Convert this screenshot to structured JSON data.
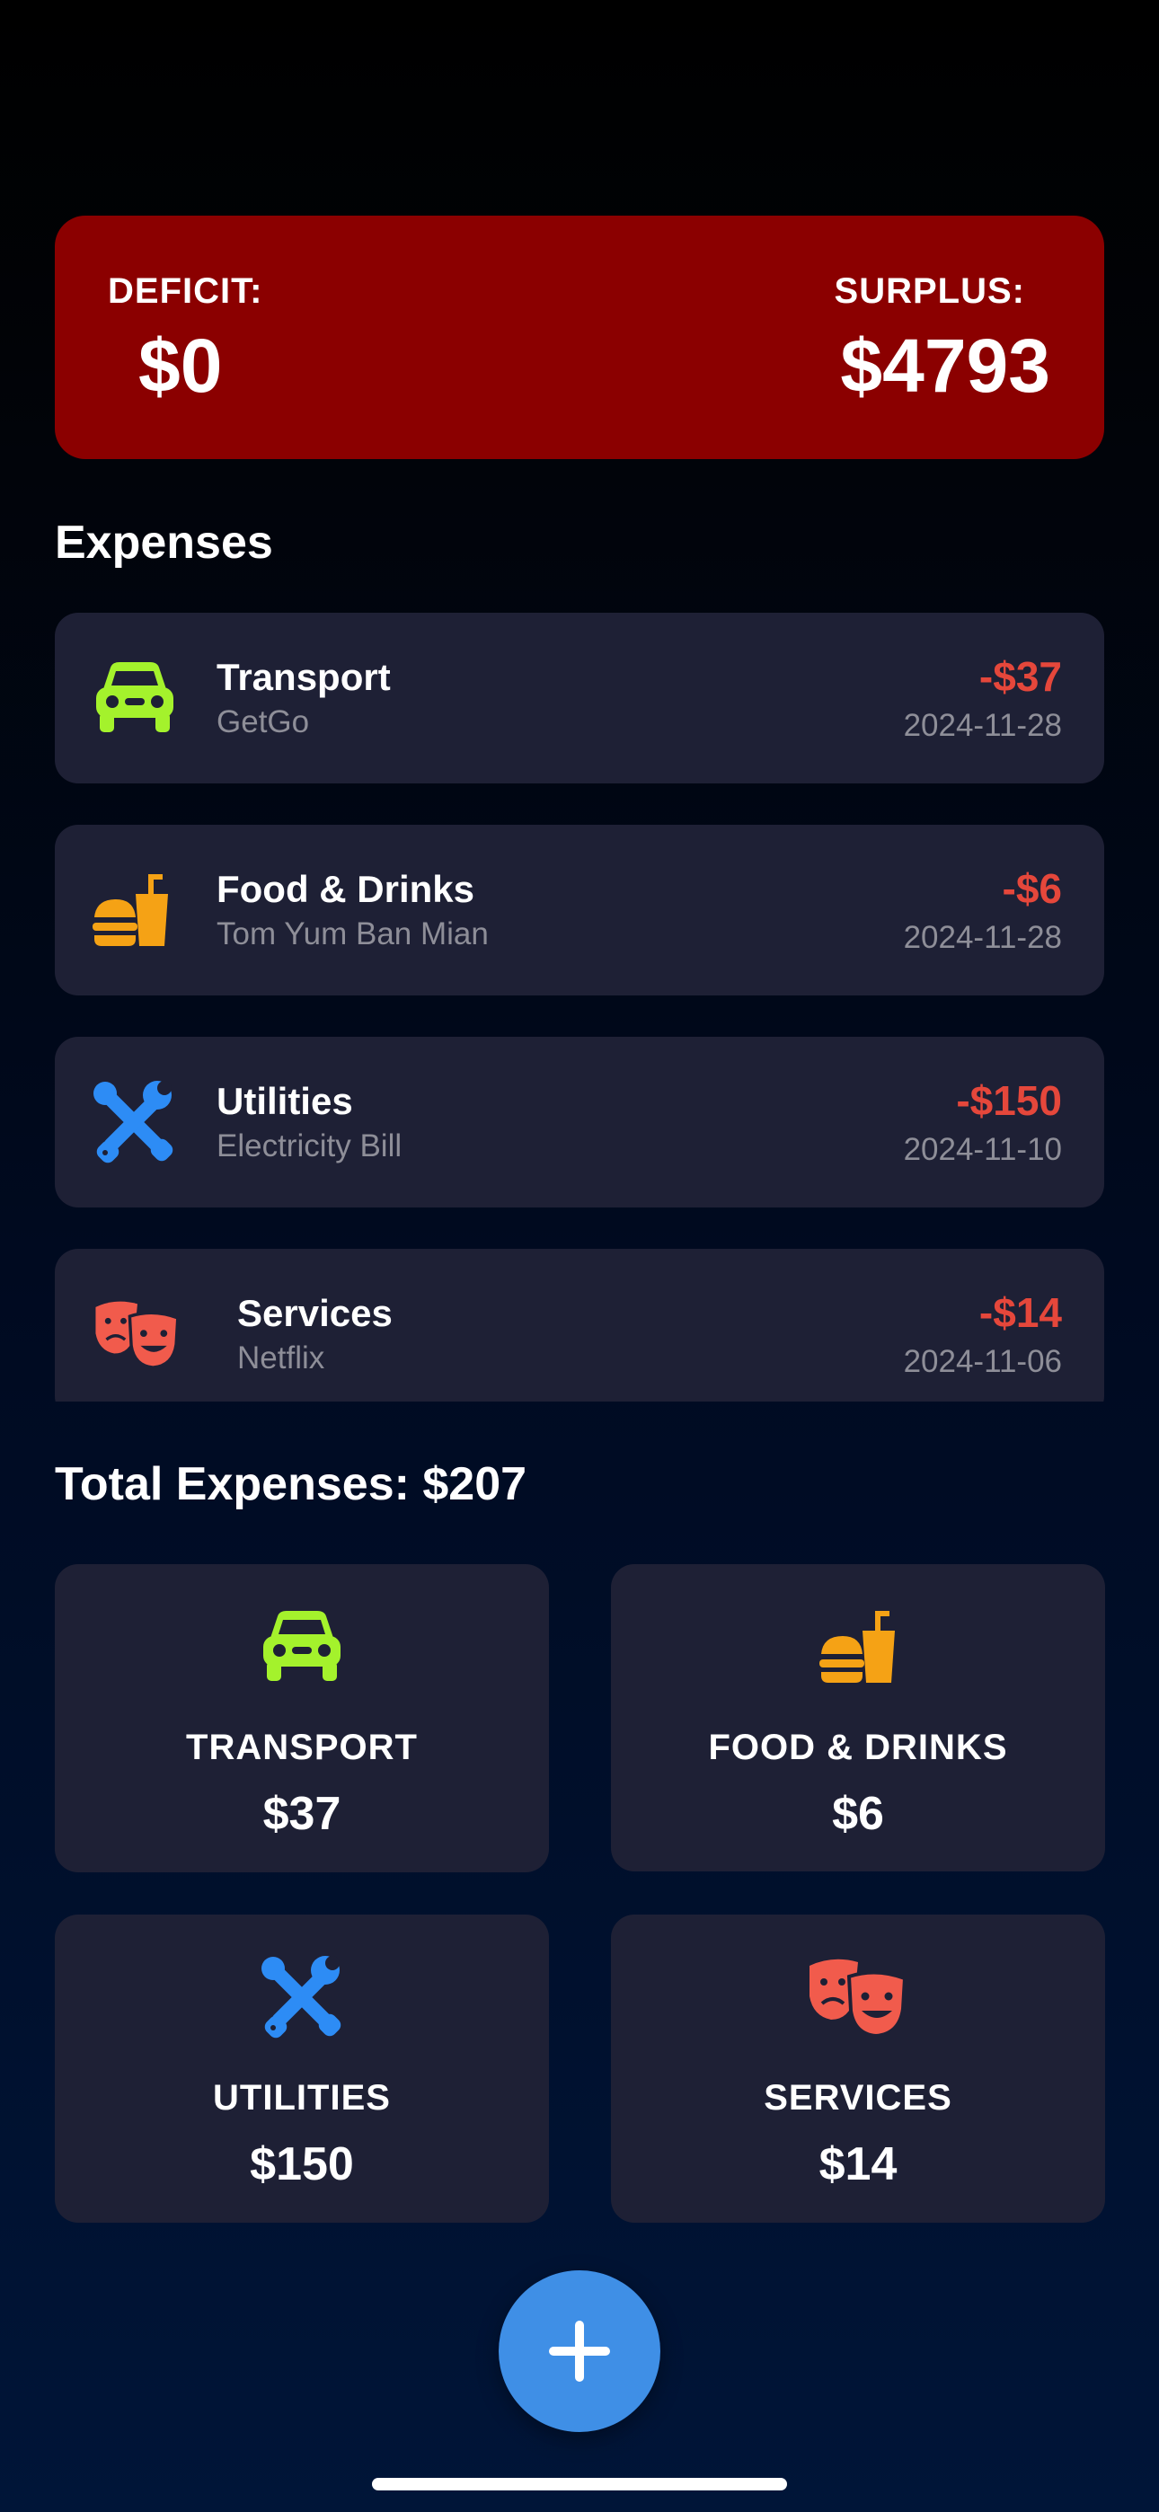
{
  "balance": {
    "deficit_label": "DEFICIT:",
    "deficit_value": "$0",
    "surplus_label": "SURPLUS:",
    "surplus_value": "$4793",
    "card_color": "#8b0000"
  },
  "expenses_section": {
    "title": "Expenses",
    "items": [
      {
        "category": "Transport",
        "description": "GetGo",
        "amount": "-$37",
        "date": "2024-11-28",
        "icon": "car-icon",
        "icon_color": "#a4f22c"
      },
      {
        "category": "Food & Drinks",
        "description": "Tom Yum Ban Mian",
        "amount": "-$6",
        "date": "2024-11-28",
        "icon": "burger-drink-icon",
        "icon_color": "#f5a215"
      },
      {
        "category": "Utilities",
        "description": "Electricity Bill",
        "amount": "-$150",
        "date": "2024-11-10",
        "icon": "wrench-screwdriver-icon",
        "icon_color": "#2d8cf5"
      },
      {
        "category": "Services",
        "description": "Netflix",
        "amount": "-$14",
        "date": "2024-11-06",
        "icon": "theater-masks-icon",
        "icon_color": "#f15b4c"
      }
    ]
  },
  "totals": {
    "label": "Total Expenses: $207",
    "categories": [
      {
        "name": "TRANSPORT",
        "amount": "$37",
        "icon": "car-icon"
      },
      {
        "name": "FOOD & DRINKS",
        "amount": "$6",
        "icon": "burger-drink-icon"
      },
      {
        "name": "UTILITIES",
        "amount": "$150",
        "icon": "wrench-screwdriver-icon"
      },
      {
        "name": "SERVICES",
        "amount": "$14",
        "icon": "theater-masks-icon"
      }
    ]
  },
  "add_button": {
    "icon": "plus-icon",
    "color": "#3f8fe6"
  },
  "colors": {
    "negative_amount": "#e5473b",
    "card_background": "#1e2035",
    "secondary_text": "#8e8e98"
  }
}
